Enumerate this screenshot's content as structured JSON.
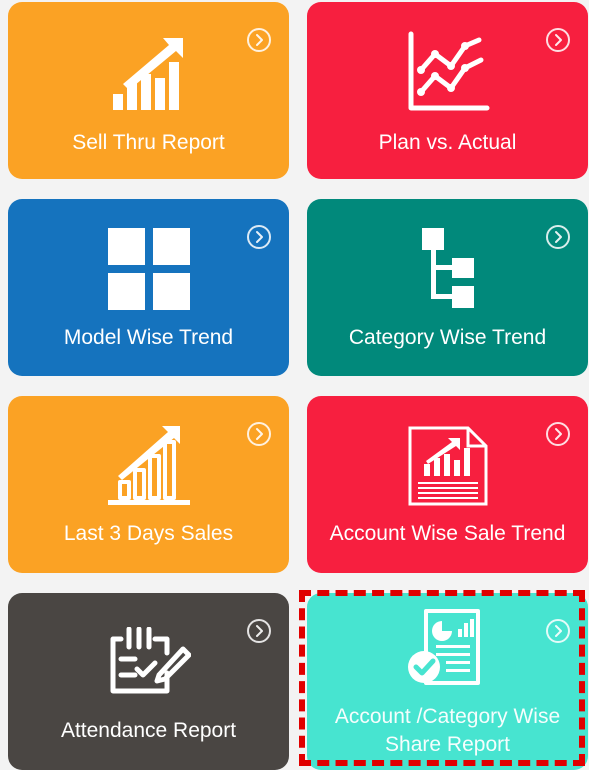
{
  "tiles": [
    {
      "label": "Sell Thru Report",
      "color": "#fba224",
      "icon": "growth-chart-icon"
    },
    {
      "label": "Plan vs. Actual",
      "color": "#f71f3f",
      "icon": "line-comparison-chart-icon"
    },
    {
      "label": "Model Wise Trend",
      "color": "#1573be",
      "icon": "grid-icon"
    },
    {
      "label": "Category Wise Trend",
      "color": "#01897b",
      "icon": "hierarchy-tree-icon"
    },
    {
      "label": "Last 3 Days Sales",
      "color": "#fba224",
      "icon": "bar-growth-icon"
    },
    {
      "label": "Account Wise Sale Trend",
      "color": "#f71f3f",
      "icon": "report-chart-icon"
    },
    {
      "label": "Attendance Report",
      "color": "#4a4643",
      "icon": "calendar-check-icon"
    },
    {
      "label": "Account /Category Wise",
      "label_line2": "Share Report",
      "color": "#47e4d0",
      "icon": "document-check-icon"
    }
  ],
  "highlight_color": "#e00000"
}
